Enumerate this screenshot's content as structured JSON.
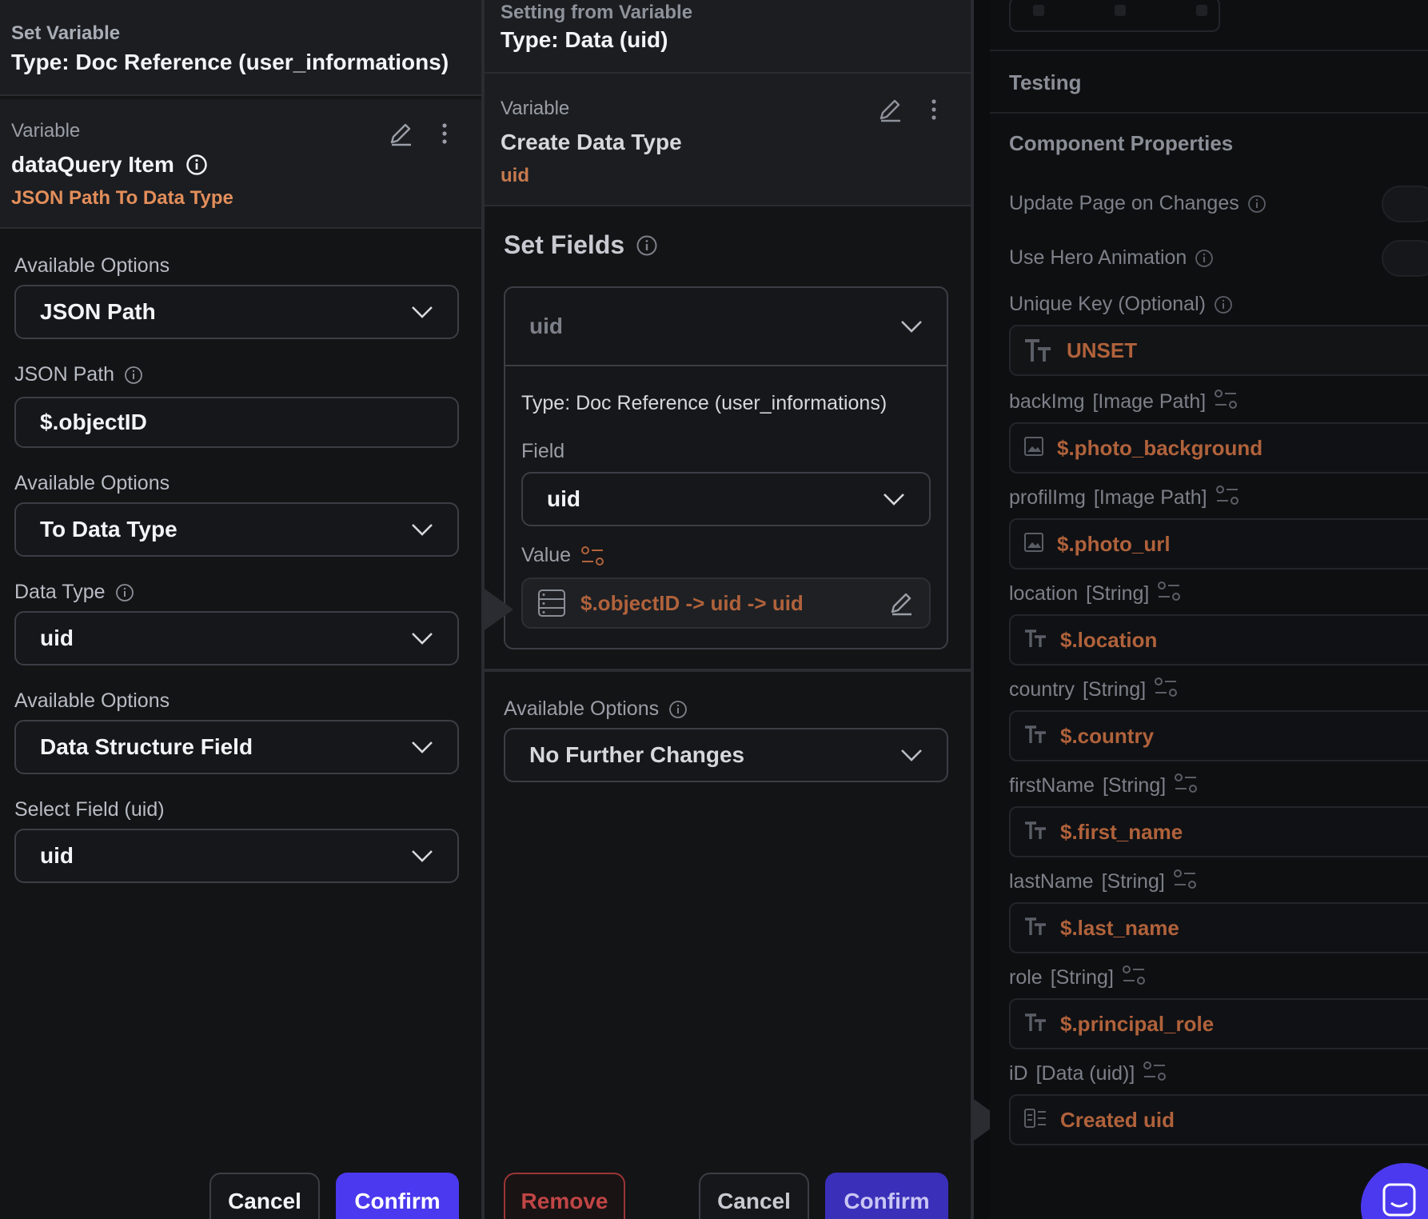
{
  "left": {
    "header_small": "Set Variable",
    "header_title": "Type: Doc Reference (user_informations)",
    "variable_small": "Variable",
    "variable_name": "dataQuery Item",
    "variable_sub": "JSON Path To Data Type",
    "fields": [
      {
        "label": "Available Options",
        "value": "JSON Path"
      },
      {
        "label": "JSON Path",
        "value": "$.objectID"
      },
      {
        "label": "Available Options",
        "value": "To Data Type"
      },
      {
        "label": "Data Type",
        "value": "uid"
      },
      {
        "label": "Available Options",
        "value": "Data Structure Field"
      },
      {
        "label": "Select Field (uid)",
        "value": "uid"
      }
    ],
    "cancel": "Cancel",
    "confirm": "Confirm"
  },
  "middle": {
    "header_small": "Setting from Variable",
    "header_title": "Type: Data (uid)",
    "variable_small": "Variable",
    "variable_name": "Create Data Type",
    "variable_sub": "uid",
    "set_fields_title": "Set Fields",
    "set_fields_selected": "uid",
    "type_text": "Type: Doc Reference (user_informations)",
    "field_label": "Field",
    "field_value": "uid",
    "value_label": "Value",
    "value_text": "$.objectID -> uid -> uid",
    "available_options_label": "Available Options",
    "available_options_value": "No Further Changes",
    "remove": "Remove",
    "cancel": "Cancel",
    "confirm": "Confirm"
  },
  "right": {
    "testing": "Testing",
    "component_properties": "Component Properties",
    "update_page": "Update Page on Changes",
    "use_hero": "Use Hero Animation",
    "unique_key_label": "Unique Key (Optional)",
    "unique_key_value": "UNSET",
    "params": [
      {
        "name": "backImg",
        "type": "[Image Path]",
        "value": "$.photo_background",
        "icon": "image-icon"
      },
      {
        "name": "profilImg",
        "type": "[Image Path]",
        "value": "$.photo_url",
        "icon": "image-icon"
      },
      {
        "name": "location",
        "type": "[String]",
        "value": "$.location",
        "icon": "text-icon"
      },
      {
        "name": "country",
        "type": "[String]",
        "value": "$.country",
        "icon": "text-icon"
      },
      {
        "name": "firstName",
        "type": "[String]",
        "value": "$.first_name",
        "icon": "text-icon"
      },
      {
        "name": "lastName",
        "type": "[String]",
        "value": "$.last_name",
        "icon": "text-icon"
      },
      {
        "name": "role",
        "type": "[String]",
        "value": "$.principal_role",
        "icon": "text-icon"
      },
      {
        "name": "iD",
        "type": "[Data (uid)]",
        "value": "Created uid",
        "icon": "data-icon"
      }
    ]
  },
  "colors": {
    "accent": "#4b39ef",
    "orange": "#e38e5a",
    "remove": "#c14545"
  }
}
